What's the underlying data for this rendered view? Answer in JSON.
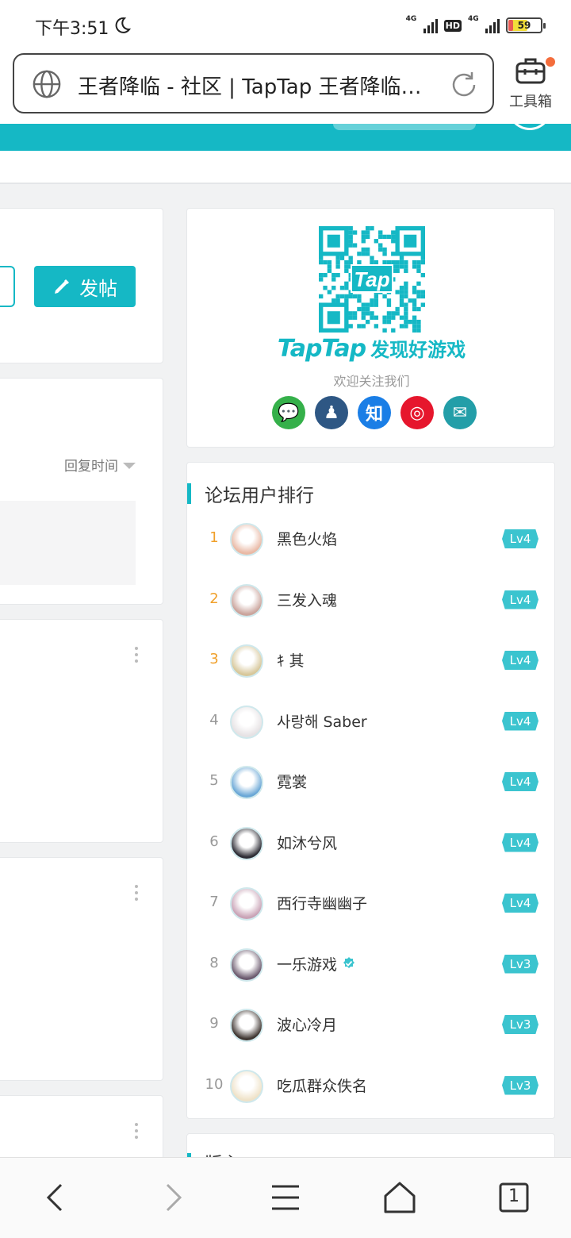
{
  "status": {
    "time": "下午3:51",
    "net1": "4G",
    "net2": "4G",
    "hd": "HD",
    "battery": "59"
  },
  "address": {
    "title": "王者降临 - 社区 | TapTap 王者降临社区"
  },
  "toolbox": {
    "label": "工具箱"
  },
  "left": {
    "post_button": "发帖",
    "sort_label": "回复时间"
  },
  "promo": {
    "brand": "TapTap",
    "slogan": "发现好游戏",
    "welcome": "欢迎关注我们",
    "socials": [
      {
        "icon": "wechat-icon",
        "color": "#35b04a"
      },
      {
        "icon": "qq-icon",
        "color": "#2e5784"
      },
      {
        "icon": "zhihu-icon",
        "color": "#1a7ee6",
        "text": "知"
      },
      {
        "icon": "weibo-icon",
        "color": "#e6162d"
      },
      {
        "icon": "mail-icon",
        "color": "#239ea8"
      }
    ]
  },
  "ranking": {
    "title": "论坛用户排行",
    "rows": [
      {
        "rank": "1",
        "name": "黑色火焰",
        "level": "Lv4",
        "avatar_color": "#e9b9a5",
        "verified": false
      },
      {
        "rank": "2",
        "name": "三发入魂",
        "level": "Lv4",
        "avatar_color": "#caa49c",
        "verified": false
      },
      {
        "rank": "3",
        "name": "ｷ 其",
        "level": "Lv4",
        "avatar_color": "#d7c79a",
        "verified": false
      },
      {
        "rank": "4",
        "name": "사랑해 Saber",
        "level": "Lv4",
        "avatar_color": "#e6e2e4",
        "verified": false
      },
      {
        "rank": "5",
        "name": "霓裳",
        "level": "Lv4",
        "avatar_color": "#6aa7d6",
        "verified": false
      },
      {
        "rank": "6",
        "name": "如沐兮风",
        "level": "Lv4",
        "avatar_color": "#2c2c34",
        "verified": false
      },
      {
        "rank": "7",
        "name": "西行寺幽幽子",
        "level": "Lv4",
        "avatar_color": "#c9a3b6",
        "verified": false
      },
      {
        "rank": "8",
        "name": "一乐游戏",
        "level": "Lv3",
        "avatar_color": "#6b5a6e",
        "verified": true
      },
      {
        "rank": "9",
        "name": "波心冷月",
        "level": "Lv3",
        "avatar_color": "#3e3530",
        "verified": false
      },
      {
        "rank": "10",
        "name": "吃瓜群众佚名",
        "level": "Lv3",
        "avatar_color": "#efe2c8",
        "verified": false
      }
    ]
  },
  "next_section": {
    "title": "版主"
  },
  "bottom_nav": {
    "tabs_count": "1"
  },
  "colors": {
    "accent": "#15b8c5",
    "rank_top": "#f0a02b"
  }
}
